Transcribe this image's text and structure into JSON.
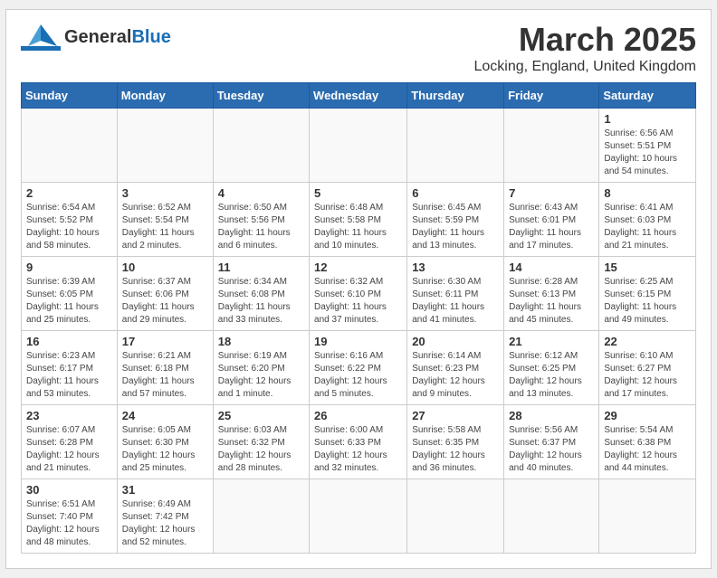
{
  "header": {
    "logo_general": "General",
    "logo_blue": "Blue",
    "month_title": "March 2025",
    "location": "Locking, England, United Kingdom"
  },
  "weekdays": [
    "Sunday",
    "Monday",
    "Tuesday",
    "Wednesday",
    "Thursday",
    "Friday",
    "Saturday"
  ],
  "weeks": [
    [
      {
        "day": "",
        "info": ""
      },
      {
        "day": "",
        "info": ""
      },
      {
        "day": "",
        "info": ""
      },
      {
        "day": "",
        "info": ""
      },
      {
        "day": "",
        "info": ""
      },
      {
        "day": "",
        "info": ""
      },
      {
        "day": "1",
        "info": "Sunrise: 6:56 AM\nSunset: 5:51 PM\nDaylight: 10 hours\nand 54 minutes."
      }
    ],
    [
      {
        "day": "2",
        "info": "Sunrise: 6:54 AM\nSunset: 5:52 PM\nDaylight: 10 hours\nand 58 minutes."
      },
      {
        "day": "3",
        "info": "Sunrise: 6:52 AM\nSunset: 5:54 PM\nDaylight: 11 hours\nand 2 minutes."
      },
      {
        "day": "4",
        "info": "Sunrise: 6:50 AM\nSunset: 5:56 PM\nDaylight: 11 hours\nand 6 minutes."
      },
      {
        "day": "5",
        "info": "Sunrise: 6:48 AM\nSunset: 5:58 PM\nDaylight: 11 hours\nand 10 minutes."
      },
      {
        "day": "6",
        "info": "Sunrise: 6:45 AM\nSunset: 5:59 PM\nDaylight: 11 hours\nand 13 minutes."
      },
      {
        "day": "7",
        "info": "Sunrise: 6:43 AM\nSunset: 6:01 PM\nDaylight: 11 hours\nand 17 minutes."
      },
      {
        "day": "8",
        "info": "Sunrise: 6:41 AM\nSunset: 6:03 PM\nDaylight: 11 hours\nand 21 minutes."
      }
    ],
    [
      {
        "day": "9",
        "info": "Sunrise: 6:39 AM\nSunset: 6:05 PM\nDaylight: 11 hours\nand 25 minutes."
      },
      {
        "day": "10",
        "info": "Sunrise: 6:37 AM\nSunset: 6:06 PM\nDaylight: 11 hours\nand 29 minutes."
      },
      {
        "day": "11",
        "info": "Sunrise: 6:34 AM\nSunset: 6:08 PM\nDaylight: 11 hours\nand 33 minutes."
      },
      {
        "day": "12",
        "info": "Sunrise: 6:32 AM\nSunset: 6:10 PM\nDaylight: 11 hours\nand 37 minutes."
      },
      {
        "day": "13",
        "info": "Sunrise: 6:30 AM\nSunset: 6:11 PM\nDaylight: 11 hours\nand 41 minutes."
      },
      {
        "day": "14",
        "info": "Sunrise: 6:28 AM\nSunset: 6:13 PM\nDaylight: 11 hours\nand 45 minutes."
      },
      {
        "day": "15",
        "info": "Sunrise: 6:25 AM\nSunset: 6:15 PM\nDaylight: 11 hours\nand 49 minutes."
      }
    ],
    [
      {
        "day": "16",
        "info": "Sunrise: 6:23 AM\nSunset: 6:17 PM\nDaylight: 11 hours\nand 53 minutes."
      },
      {
        "day": "17",
        "info": "Sunrise: 6:21 AM\nSunset: 6:18 PM\nDaylight: 11 hours\nand 57 minutes."
      },
      {
        "day": "18",
        "info": "Sunrise: 6:19 AM\nSunset: 6:20 PM\nDaylight: 12 hours\nand 1 minute."
      },
      {
        "day": "19",
        "info": "Sunrise: 6:16 AM\nSunset: 6:22 PM\nDaylight: 12 hours\nand 5 minutes."
      },
      {
        "day": "20",
        "info": "Sunrise: 6:14 AM\nSunset: 6:23 PM\nDaylight: 12 hours\nand 9 minutes."
      },
      {
        "day": "21",
        "info": "Sunrise: 6:12 AM\nSunset: 6:25 PM\nDaylight: 12 hours\nand 13 minutes."
      },
      {
        "day": "22",
        "info": "Sunrise: 6:10 AM\nSunset: 6:27 PM\nDaylight: 12 hours\nand 17 minutes."
      }
    ],
    [
      {
        "day": "23",
        "info": "Sunrise: 6:07 AM\nSunset: 6:28 PM\nDaylight: 12 hours\nand 21 minutes."
      },
      {
        "day": "24",
        "info": "Sunrise: 6:05 AM\nSunset: 6:30 PM\nDaylight: 12 hours\nand 25 minutes."
      },
      {
        "day": "25",
        "info": "Sunrise: 6:03 AM\nSunset: 6:32 PM\nDaylight: 12 hours\nand 28 minutes."
      },
      {
        "day": "26",
        "info": "Sunrise: 6:00 AM\nSunset: 6:33 PM\nDaylight: 12 hours\nand 32 minutes."
      },
      {
        "day": "27",
        "info": "Sunrise: 5:58 AM\nSunset: 6:35 PM\nDaylight: 12 hours\nand 36 minutes."
      },
      {
        "day": "28",
        "info": "Sunrise: 5:56 AM\nSunset: 6:37 PM\nDaylight: 12 hours\nand 40 minutes."
      },
      {
        "day": "29",
        "info": "Sunrise: 5:54 AM\nSunset: 6:38 PM\nDaylight: 12 hours\nand 44 minutes."
      }
    ],
    [
      {
        "day": "30",
        "info": "Sunrise: 6:51 AM\nSunset: 7:40 PM\nDaylight: 12 hours\nand 48 minutes."
      },
      {
        "day": "31",
        "info": "Sunrise: 6:49 AM\nSunset: 7:42 PM\nDaylight: 12 hours\nand 52 minutes."
      },
      {
        "day": "",
        "info": ""
      },
      {
        "day": "",
        "info": ""
      },
      {
        "day": "",
        "info": ""
      },
      {
        "day": "",
        "info": ""
      },
      {
        "day": "",
        "info": ""
      }
    ]
  ]
}
